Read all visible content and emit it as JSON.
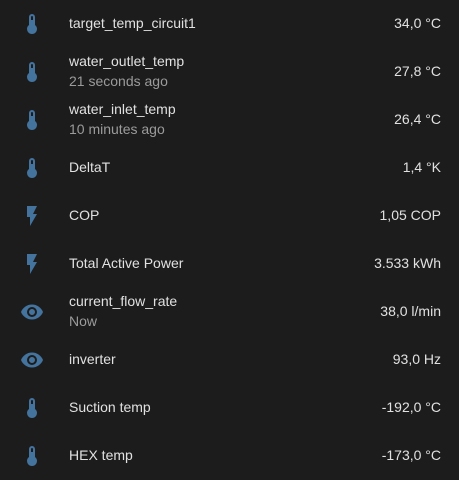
{
  "icon_color": "#44739e",
  "entities": [
    {
      "name": "target_temp_circuit1",
      "secondary": "",
      "value": "34,0 °C",
      "icon": "thermometer-icon"
    },
    {
      "name": "water_outlet_temp",
      "secondary": "21 seconds ago",
      "value": "27,8 °C",
      "icon": "thermometer-icon"
    },
    {
      "name": "water_inlet_temp",
      "secondary": "10 minutes ago",
      "value": "26,4 °C",
      "icon": "thermometer-icon"
    },
    {
      "name": "DeltaT",
      "secondary": "",
      "value": "1,4 °K",
      "icon": "thermometer-icon"
    },
    {
      "name": "COP",
      "secondary": "",
      "value": "1,05 COP",
      "icon": "flash-icon"
    },
    {
      "name": "Total Active Power",
      "secondary": "",
      "value": "3.533 kWh",
      "icon": "flash-icon"
    },
    {
      "name": "current_flow_rate",
      "secondary": "Now",
      "value": "38,0 l/min",
      "icon": "eye-icon"
    },
    {
      "name": "inverter",
      "secondary": "",
      "value": "93,0 Hz",
      "icon": "eye-icon"
    },
    {
      "name": "Suction temp",
      "secondary": "",
      "value": "-192,0 °C",
      "icon": "thermometer-icon"
    },
    {
      "name": "HEX temp",
      "secondary": "",
      "value": "-173,0 °C",
      "icon": "thermometer-icon"
    }
  ]
}
